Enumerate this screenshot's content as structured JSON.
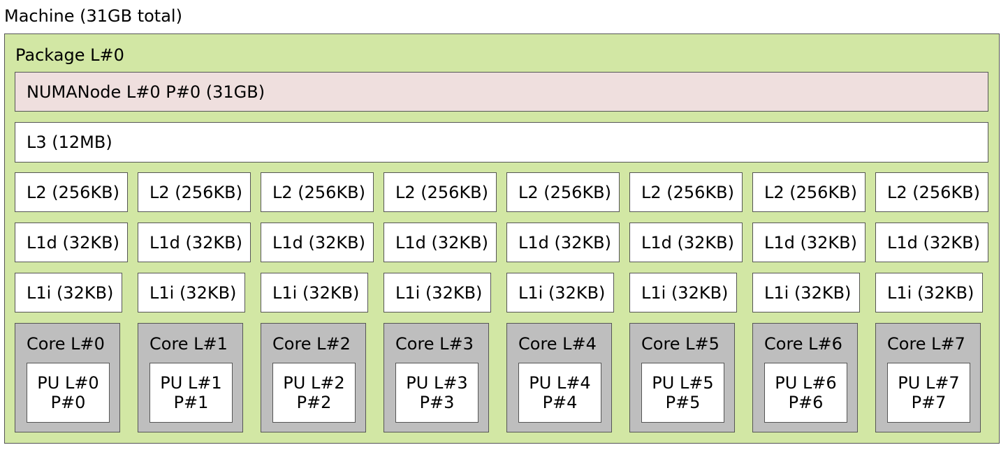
{
  "machine": {
    "label": "Machine (31GB total)"
  },
  "package": {
    "label": "Package L#0"
  },
  "numa": {
    "label": "NUMANode L#0 P#0 (31GB)"
  },
  "l3": {
    "label": "L3 (12MB)"
  },
  "cores": [
    {
      "l2": "L2 (256KB)",
      "l1d": "L1d (32KB)",
      "l1i": "L1i (32KB)",
      "core": "Core L#0",
      "pu": "PU L#0",
      "pu_p": "P#0"
    },
    {
      "l2": "L2 (256KB)",
      "l1d": "L1d (32KB)",
      "l1i": "L1i (32KB)",
      "core": "Core L#1",
      "pu": "PU L#1",
      "pu_p": "P#1"
    },
    {
      "l2": "L2 (256KB)",
      "l1d": "L1d (32KB)",
      "l1i": "L1i (32KB)",
      "core": "Core L#2",
      "pu": "PU L#2",
      "pu_p": "P#2"
    },
    {
      "l2": "L2 (256KB)",
      "l1d": "L1d (32KB)",
      "l1i": "L1i (32KB)",
      "core": "Core L#3",
      "pu": "PU L#3",
      "pu_p": "P#3"
    },
    {
      "l2": "L2 (256KB)",
      "l1d": "L1d (32KB)",
      "l1i": "L1i (32KB)",
      "core": "Core L#4",
      "pu": "PU L#4",
      "pu_p": "P#4"
    },
    {
      "l2": "L2 (256KB)",
      "l1d": "L1d (32KB)",
      "l1i": "L1i (32KB)",
      "core": "Core L#5",
      "pu": "PU L#5",
      "pu_p": "P#5"
    },
    {
      "l2": "L2 (256KB)",
      "l1d": "L1d (32KB)",
      "l1i": "L1i (32KB)",
      "core": "Core L#6",
      "pu": "PU L#6",
      "pu_p": "P#6"
    },
    {
      "l2": "L2 (256KB)",
      "l1d": "L1d (32KB)",
      "l1i": "L1i (32KB)",
      "core": "Core L#7",
      "pu": "PU L#7",
      "pu_p": "P#7"
    }
  ],
  "colors": {
    "package": "#d2e7a4",
    "numa": "#efdfde",
    "cache": "#ffffff",
    "core": "#bebebe",
    "pu": "#ffffff",
    "border": "#555555"
  }
}
